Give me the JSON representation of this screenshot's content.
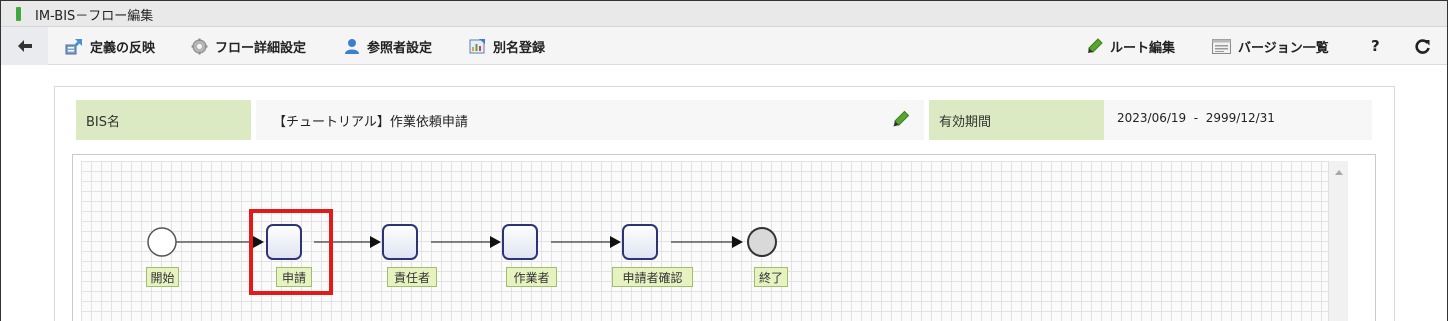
{
  "window": {
    "title": "IM-BIS－フロー編集"
  },
  "toolbar": {
    "back_icon": "arrow-left-icon",
    "items": [
      {
        "label": "定義の反映",
        "icon": "apply-definition-icon"
      },
      {
        "label": "フロー詳細設定",
        "icon": "gear-icon"
      },
      {
        "label": "参照者設定",
        "icon": "user-icon"
      },
      {
        "label": "別名登録",
        "icon": "alias-register-icon"
      }
    ],
    "right_items": [
      {
        "label": "ルート編集",
        "icon": "pencil-icon"
      },
      {
        "label": "バージョン一覧",
        "icon": "version-list-icon"
      }
    ],
    "help_label": "?",
    "refresh_icon": "refresh-icon"
  },
  "bis": {
    "name_label": "BIS名",
    "name_value": "【チュートリアル】作業依頼申請",
    "period_label": "有効期間",
    "period_value": "2023/06/19  -  2999/12/31"
  },
  "flow": {
    "nodes": [
      {
        "type": "start",
        "label": "開始"
      },
      {
        "type": "task",
        "label": "申請",
        "highlighted": true
      },
      {
        "type": "task",
        "label": "責任者"
      },
      {
        "type": "task",
        "label": "作業者"
      },
      {
        "type": "task",
        "label": "申請者確認"
      },
      {
        "type": "end",
        "label": "終了"
      }
    ]
  },
  "colors": {
    "label_bg": "#dceac3",
    "node_label_bg": "#e6f2c0",
    "highlight": "#e21a1a",
    "accent_green": "#3fa83f"
  }
}
